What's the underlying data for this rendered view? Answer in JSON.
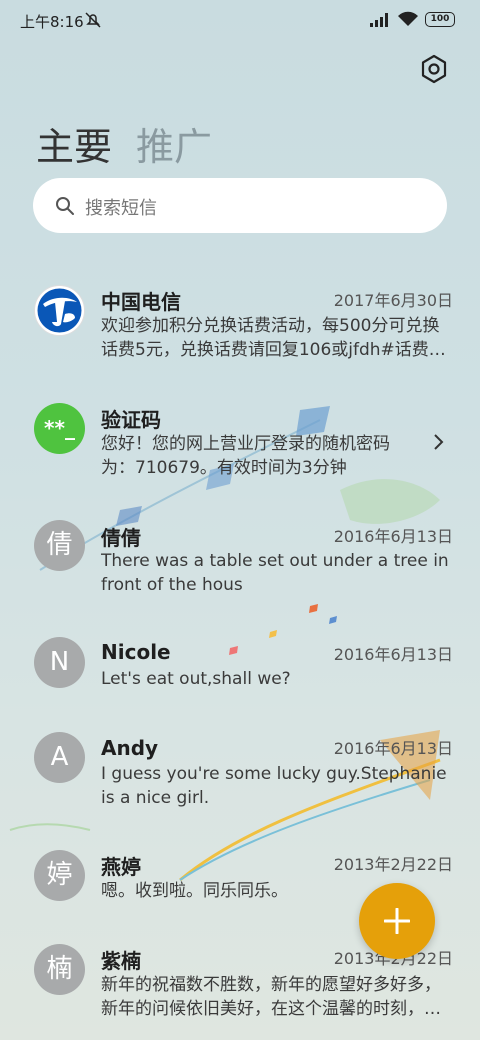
{
  "status": {
    "time": "上午8:16",
    "battery": "100"
  },
  "tabs": {
    "main": "主要",
    "promo": "推广"
  },
  "search": {
    "placeholder": "搜索短信"
  },
  "messages": [
    {
      "name": "中国电信",
      "date": "2017年6月30日",
      "preview": "欢迎参加积分兑换话费活动，每500分可兑换话费5元，兑换话费请回复106或jfdh#话费…",
      "avatar": "telecom-logo"
    },
    {
      "name": "验证码",
      "date": "",
      "preview": "您好！您的网上营业厅登录的随机密码为：710679。有效时间为3分钟",
      "avatar_text": "**_"
    },
    {
      "name": "倩倩",
      "date": "2016年6月13日",
      "preview": "There was a table set out under a tree in front of the hous",
      "avatar_text": "倩"
    },
    {
      "name": "Nicole",
      "date": "2016年6月13日",
      "preview": "Let's eat out,shall we?",
      "avatar_text": "N"
    },
    {
      "name": "Andy",
      "date": "2016年6月13日",
      "preview": "I guess you're some lucky guy.Stephanie is a nice girl.",
      "avatar_text": "A"
    },
    {
      "name": "燕婷",
      "date": "2013年2月22日",
      "preview": "嗯。收到啦。同乐同乐。",
      "avatar_text": "婷"
    },
    {
      "name": "紫楠",
      "date": "2013年2月22日",
      "preview": "新年的祝福数不胜数，新年的愿望好多好多，新年的问候依旧美好，在这个温馨的时刻，…",
      "avatar_text": "楠"
    }
  ],
  "colors": {
    "fab": "#e5a00a",
    "verify_avatar": "#4fc33f",
    "avatar_gray": "#a8aaab"
  }
}
